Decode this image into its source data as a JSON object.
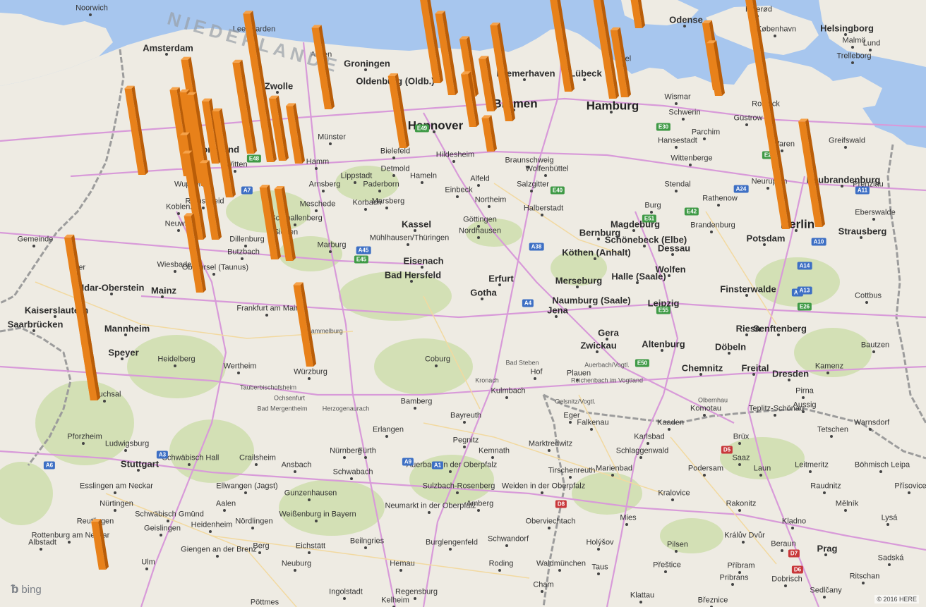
{
  "map": {
    "attribution": "© 2016 HERE",
    "logo_text": "bing",
    "logo_icon": "bing-b-icon",
    "colors": {
      "water": "#a7c6ee",
      "land": "#eeebe3",
      "forest": "#c9dca5",
      "roads": "#d89ad9",
      "minor_roads": "#f2d9a0",
      "borders": "#9c9c9c",
      "column_front": "#e8811a",
      "column_side": "#b95d08",
      "column_top": "#f6a24a"
    },
    "countries": [
      {
        "name": "NIEDERLANDE"
      }
    ],
    "cities_major": [
      "Hamburg",
      "Berlin",
      "Bremen",
      "Hannover",
      "Leipzig",
      "Dresden",
      "Chemnitz",
      "Prag",
      "Stuttgart",
      "Frankfurt am Main",
      "Dortmund",
      "Wuppertal"
    ],
    "cities": [
      {
        "name": "Hamburg",
        "rank": 1
      },
      {
        "name": "Berlin",
        "rank": 1
      },
      {
        "name": "Bremen",
        "rank": 1
      },
      {
        "name": "Hannover",
        "rank": 1
      },
      {
        "name": "Leipzig",
        "rank": 2
      },
      {
        "name": "Dresden",
        "rank": 2
      },
      {
        "name": "Chemnitz",
        "rank": 2
      },
      {
        "name": "Prag",
        "rank": 2
      },
      {
        "name": "Stuttgart",
        "rank": 2
      },
      {
        "name": "Frankfurt am Main",
        "rank": 3
      },
      {
        "name": "Dortmund",
        "rank": 2
      },
      {
        "name": "Wuppertal",
        "rank": 3
      },
      {
        "name": "Zwickau",
        "rank": 2
      },
      {
        "name": "Altenburg",
        "rank": 2
      },
      {
        "name": "Gera",
        "rank": 2
      },
      {
        "name": "Jena",
        "rank": 2
      },
      {
        "name": "Erfurt",
        "rank": 2
      },
      {
        "name": "Gotha",
        "rank": 2
      },
      {
        "name": "Eisenach",
        "rank": 2
      },
      {
        "name": "Halle (Saale)",
        "rank": 2
      },
      {
        "name": "Naumburg (Saale)",
        "rank": 2
      },
      {
        "name": "Dessau",
        "rank": 2
      },
      {
        "name": "Wolfen",
        "rank": 2
      },
      {
        "name": "Magdeburg",
        "rank": 2
      },
      {
        "name": "Schönebeck (Elbe)",
        "rank": 2
      },
      {
        "name": "Bernburg",
        "rank": 2
      },
      {
        "name": "Köthen (Anhalt)",
        "rank": 2
      },
      {
        "name": "Merseburg",
        "rank": 2
      },
      {
        "name": "Potsdam",
        "rank": 2
      },
      {
        "name": "Brandenburg",
        "rank": 3
      },
      {
        "name": "Strausberg",
        "rank": 2
      },
      {
        "name": "Neubrandenburg",
        "rank": 2
      },
      {
        "name": "Neuruppin",
        "rank": 3
      },
      {
        "name": "Rathenow",
        "rank": 3
      },
      {
        "name": "Stendal",
        "rank": 3
      },
      {
        "name": "Wittenberge",
        "rank": 3
      },
      {
        "name": "Schwerin",
        "rank": 3
      },
      {
        "name": "Güstrow",
        "rank": 3
      },
      {
        "name": "Rostock",
        "rank": 3
      },
      {
        "name": "Wismar",
        "rank": 3
      },
      {
        "name": "Lübeck",
        "rank": 2
      },
      {
        "name": "Kiel",
        "rank": 3
      },
      {
        "name": "Bremerhaven",
        "rank": 2
      },
      {
        "name": "Oldenburg (Oldb.)",
        "rank": 2
      },
      {
        "name": "Groningen",
        "rank": 2
      },
      {
        "name": "Assen",
        "rank": 3
      },
      {
        "name": "Zwolle",
        "rank": 2
      },
      {
        "name": "Amsterdam",
        "rank": 2
      },
      {
        "name": "Leeuwarden",
        "rank": 3
      },
      {
        "name": "Odense",
        "rank": 2
      },
      {
        "name": "København",
        "rank": 3
      },
      {
        "name": "Hillerød",
        "rank": 3
      },
      {
        "name": "Helsingborg",
        "rank": 2
      },
      {
        "name": "Lund",
        "rank": 3
      },
      {
        "name": "Trelleborg",
        "rank": 3
      },
      {
        "name": "Malmö",
        "rank": 3
      },
      {
        "name": "Hildesheim",
        "rank": 3
      },
      {
        "name": "Braunschweig",
        "rank": 3
      },
      {
        "name": "Salzgitter",
        "rank": 3
      },
      {
        "name": "Wolfenbüttel",
        "rank": 3
      },
      {
        "name": "Burg",
        "rank": 3
      },
      {
        "name": "Halberstadt",
        "rank": 3
      },
      {
        "name": "Göttingen",
        "rank": 3
      },
      {
        "name": "Nordhausen",
        "rank": 3
      },
      {
        "name": "Northeim",
        "rank": 3
      },
      {
        "name": "Einbeck",
        "rank": 3
      },
      {
        "name": "Alfeld",
        "rank": 3
      },
      {
        "name": "Hameln",
        "rank": 3
      },
      {
        "name": "Detmold",
        "rank": 3
      },
      {
        "name": "Paderborn",
        "rank": 3
      },
      {
        "name": "Lippstadt",
        "rank": 3
      },
      {
        "name": "Bielefeld",
        "rank": 3
      },
      {
        "name": "Münster",
        "rank": 3
      },
      {
        "name": "Hamm",
        "rank": 3
      },
      {
        "name": "Arnsberg",
        "rank": 3
      },
      {
        "name": "Meschede",
        "rank": 3
      },
      {
        "name": "Schmallenberg",
        "rank": 3
      },
      {
        "name": "Siegen",
        "rank": 3
      },
      {
        "name": "Dillenburg",
        "rank": 3
      },
      {
        "name": "Marburg",
        "rank": 3
      },
      {
        "name": "Korbach",
        "rank": 3
      },
      {
        "name": "Kassel",
        "rank": 2
      },
      {
        "name": "Marsberg",
        "rank": 3
      },
      {
        "name": "Mühlhausen/Thüringen",
        "rank": 3
      },
      {
        "name": "Bad Hersfeld",
        "rank": 2
      },
      {
        "name": "Remscheid",
        "rank": 3
      },
      {
        "name": "Witten",
        "rank": 3
      },
      {
        "name": "Neuwied",
        "rank": 3
      },
      {
        "name": "Koblenz",
        "rank": 3
      },
      {
        "name": "Butzbach",
        "rank": 3
      },
      {
        "name": "Oberursel (Taunus)",
        "rank": 3
      },
      {
        "name": "Wiesbaden",
        "rank": 3
      },
      {
        "name": "Mainz",
        "rank": 2
      },
      {
        "name": "Idar-Oberstein",
        "rank": 2
      },
      {
        "name": "Kaiserslautern",
        "rank": 2
      },
      {
        "name": "Mannheim",
        "rank": 2
      },
      {
        "name": "Saarbrücken",
        "rank": 2
      },
      {
        "name": "Speyer",
        "rank": 2
      },
      {
        "name": "Trier",
        "rank": 3
      },
      {
        "name": "Würzburg",
        "rank": 3
      },
      {
        "name": "Hammelburg",
        "rank": 4
      },
      {
        "name": "Bad Mergentheim",
        "rank": 4
      },
      {
        "name": "Herzogenaurach",
        "rank": 4
      },
      {
        "name": "Nürnberg",
        "rank": 3
      },
      {
        "name": "Fürth",
        "rank": 3
      },
      {
        "name": "Ansbach",
        "rank": 3
      },
      {
        "name": "Schwabach",
        "rank": 3
      },
      {
        "name": "Erlangen",
        "rank": 3
      },
      {
        "name": "Bamberg",
        "rank": 3
      },
      {
        "name": "Bayreuth",
        "rank": 3
      },
      {
        "name": "Kulmbach",
        "rank": 3
      },
      {
        "name": "Hof",
        "rank": 3
      },
      {
        "name": "Kronach",
        "rank": 4
      },
      {
        "name": "Bad Steben",
        "rank": 4
      },
      {
        "name": "Coburg",
        "rank": 3
      },
      {
        "name": "Pegnitz",
        "rank": 3
      },
      {
        "name": "Kemnath",
        "rank": 3
      },
      {
        "name": "Marktredwitz",
        "rank": 3
      },
      {
        "name": "Tirschenreuth",
        "rank": 3
      },
      {
        "name": "Weiden in der Oberpfalz",
        "rank": 3
      },
      {
        "name": "Auerbach in der Oberpfalz",
        "rank": 3
      },
      {
        "name": "Sulzbach-Rosenberg",
        "rank": 3
      },
      {
        "name": "Amberg",
        "rank": 3
      },
      {
        "name": "Neumarkt in der Oberpfalz",
        "rank": 3
      },
      {
        "name": "Schwandorf",
        "rank": 3
      },
      {
        "name": "Burglengenfeld",
        "rank": 3
      },
      {
        "name": "Regensburg",
        "rank": 3
      },
      {
        "name": "Hemau",
        "rank": 3
      },
      {
        "name": "Beilngries",
        "rank": 3
      },
      {
        "name": "Eichstätt",
        "rank": 3
      },
      {
        "name": "Ingolstadt",
        "rank": 3
      },
      {
        "name": "Neuburg",
        "rank": 3
      },
      {
        "name": "Weißenburg in Bayern",
        "rank": 3
      },
      {
        "name": "Gunzenhausen",
        "rank": 3
      },
      {
        "name": "Nördlingen",
        "rank": 3
      },
      {
        "name": "Ellwangen (Jagst)",
        "rank": 3
      },
      {
        "name": "Aalen",
        "rank": 3
      },
      {
        "name": "Heidenheim",
        "rank": 3
      },
      {
        "name": "Schwäbisch Hall",
        "rank": 3
      },
      {
        "name": "Schwäbisch Gmünd",
        "rank": 3
      },
      {
        "name": "Crailsheim",
        "rank": 3
      },
      {
        "name": "Giengen an der Brenz",
        "rank": 3
      },
      {
        "name": "Ulm",
        "rank": 3
      },
      {
        "name": "Geislingen",
        "rank": 3
      },
      {
        "name": "Esslingen am Neckar",
        "rank": 3
      },
      {
        "name": "Reutlingen",
        "rank": 3
      },
      {
        "name": "Nürtingen",
        "rank": 3
      },
      {
        "name": "Rottenburg am Neckar",
        "rank": 3
      },
      {
        "name": "Albstadt",
        "rank": 3
      },
      {
        "name": "Ludwigsburg",
        "rank": 3
      },
      {
        "name": "Heidelberg",
        "rank": 3
      },
      {
        "name": "Bruchsal",
        "rank": 3
      },
      {
        "name": "Pforzheim",
        "rank": 3
      },
      {
        "name": "Wertheim",
        "rank": 3
      },
      {
        "name": "Tauberbischofsheim",
        "rank": 4
      },
      {
        "name": "Ochsenfurt",
        "rank": 4
      },
      {
        "name": "Berg",
        "rank": 3
      },
      {
        "name": "Pöttmes",
        "rank": 3
      },
      {
        "name": "Kelheim",
        "rank": 3
      },
      {
        "name": "Roding",
        "rank": 3
      },
      {
        "name": "Cham",
        "rank": 3
      },
      {
        "name": "Waldmünchen",
        "rank": 3
      },
      {
        "name": "Oberviechtach",
        "rank": 3
      },
      {
        "name": "Marienbad",
        "rank": 3
      },
      {
        "name": "Schlaggenwald",
        "rank": 3
      },
      {
        "name": "Karlsbad",
        "rank": 3
      },
      {
        "name": "Falkenau",
        "rank": 3
      },
      {
        "name": "Eger",
        "rank": 3
      },
      {
        "name": "Kaaden",
        "rank": 3
      },
      {
        "name": "Komotau",
        "rank": 3
      },
      {
        "name": "Brüx",
        "rank": 3
      },
      {
        "name": "Teplitz-Schönau",
        "rank": 3
      },
      {
        "name": "Aussig",
        "rank": 3
      },
      {
        "name": "Tetschen",
        "rank": 3
      },
      {
        "name": "Böhmisch Leipa",
        "rank": 3
      },
      {
        "name": "Leitmeritz",
        "rank": 3
      },
      {
        "name": "Raudnitz",
        "rank": 3
      },
      {
        "name": "Mělník",
        "rank": 3
      },
      {
        "name": "Kladno",
        "rank": 3
      },
      {
        "name": "Rakonitz",
        "rank": 3
      },
      {
        "name": "Podersam",
        "rank": 3
      },
      {
        "name": "Saaz",
        "rank": 3
      },
      {
        "name": "Laun",
        "rank": 3
      },
      {
        "name": "Kralovice",
        "rank": 3
      },
      {
        "name": "Mies",
        "rank": 3
      },
      {
        "name": "Pilsen",
        "rank": 3
      },
      {
        "name": "Holýšov",
        "rank": 3
      },
      {
        "name": "Taus",
        "rank": 3
      },
      {
        "name": "Přeštice",
        "rank": 3
      },
      {
        "name": "Klattau",
        "rank": 3
      },
      {
        "name": "Pribrans",
        "rank": 3
      },
      {
        "name": "Příbram",
        "rank": 3
      },
      {
        "name": "Beraun",
        "rank": 3
      },
      {
        "name": "Králův Dvůr",
        "rank": 3
      },
      {
        "name": "Dobrisch",
        "rank": 3
      },
      {
        "name": "Březnice",
        "rank": 3
      },
      {
        "name": "Sedlčany",
        "rank": 3
      },
      {
        "name": "Ritschan",
        "rank": 3
      },
      {
        "name": "Sadská",
        "rank": 3
      },
      {
        "name": "Lysá",
        "rank": 3
      },
      {
        "name": "Přísovice",
        "rank": 3
      },
      {
        "name": "Riesa",
        "rank": 2
      },
      {
        "name": "Finsterwalde",
        "rank": 2
      },
      {
        "name": "Senftenberg",
        "rank": 2
      },
      {
        "name": "Döbeln",
        "rank": 2
      },
      {
        "name": "Freital",
        "rank": 2
      },
      {
        "name": "Plauen",
        "rank": 3
      },
      {
        "name": "Auerbach/Vogtl.",
        "rank": 4
      },
      {
        "name": "Oelsnitz/Vogtl.",
        "rank": 4
      },
      {
        "name": "Reichenbach im Vogtland",
        "rank": 4
      },
      {
        "name": "Olbernhau",
        "rank": 4
      },
      {
        "name": "Pirna",
        "rank": 3
      },
      {
        "name": "Warnsdorf",
        "rank": 3
      },
      {
        "name": "Kamenz",
        "rank": 3
      },
      {
        "name": "Bautzen",
        "rank": 3
      },
      {
        "name": "Cottbus",
        "rank": 3
      },
      {
        "name": "Eberswalde",
        "rank": 3
      },
      {
        "name": "Prenzlau",
        "rank": 3
      },
      {
        "name": "Greifswald",
        "rank": 3
      },
      {
        "name": "Waren",
        "rank": 3
      },
      {
        "name": "Parchim",
        "rank": 3
      },
      {
        "name": "Hansestadt",
        "rank": 3
      },
      {
        "name": "Gemeinde",
        "rank": 3
      },
      {
        "name": "Noorwich",
        "rank": 3
      }
    ],
    "road_shields": [
      {
        "label": "A1",
        "type": "A"
      },
      {
        "label": "A2",
        "type": "A"
      },
      {
        "label": "A4",
        "type": "A"
      },
      {
        "label": "A7",
        "type": "A"
      },
      {
        "label": "A9",
        "type": "A"
      },
      {
        "label": "A10",
        "type": "A"
      },
      {
        "label": "A11",
        "type": "A"
      },
      {
        "label": "A13",
        "type": "A"
      },
      {
        "label": "A14",
        "type": "A"
      },
      {
        "label": "A24",
        "type": "A"
      },
      {
        "label": "A38",
        "type": "A"
      },
      {
        "label": "A45",
        "type": "A"
      },
      {
        "label": "A6",
        "type": "A"
      },
      {
        "label": "A3",
        "type": "A"
      },
      {
        "label": "E30",
        "type": "E"
      },
      {
        "label": "E40",
        "type": "E"
      },
      {
        "label": "E45",
        "type": "E"
      },
      {
        "label": "E48",
        "type": "E"
      },
      {
        "label": "E49",
        "type": "E"
      },
      {
        "label": "E51",
        "type": "E"
      },
      {
        "label": "E55",
        "type": "E"
      },
      {
        "label": "E26",
        "type": "E"
      },
      {
        "label": "E22",
        "type": "E"
      },
      {
        "label": "E42",
        "type": "E"
      },
      {
        "label": "E50",
        "type": "E"
      },
      {
        "label": "D5",
        "type": "D"
      },
      {
        "label": "D6",
        "type": "D"
      },
      {
        "label": "D7",
        "type": "D"
      },
      {
        "label": "D8",
        "type": "D"
      }
    ],
    "data_columns_count": 38,
    "data_columns": [
      {
        "id": 1,
        "value": 100
      },
      {
        "id": 2,
        "value": 44
      },
      {
        "id": 3,
        "value": 22
      },
      {
        "id": 4,
        "value": 50
      },
      {
        "id": 5,
        "value": 28
      },
      {
        "id": 6,
        "value": 80
      },
      {
        "id": 7,
        "value": 40
      },
      {
        "id": 8,
        "value": 22
      },
      {
        "id": 9,
        "value": 14
      },
      {
        "id": 10,
        "value": 22
      },
      {
        "id": 11,
        "value": 24
      },
      {
        "id": 12,
        "value": 34
      },
      {
        "id": 13,
        "value": 40
      },
      {
        "id": 14,
        "value": 30
      },
      {
        "id": 15,
        "value": 34
      },
      {
        "id": 16,
        "value": 24
      },
      {
        "id": 17,
        "value": 26
      },
      {
        "id": 18,
        "value": 62
      },
      {
        "id": 19,
        "value": 38
      },
      {
        "id": 20,
        "value": 36
      },
      {
        "id": 21,
        "value": 26
      },
      {
        "id": 22,
        "value": 36
      },
      {
        "id": 23,
        "value": 38
      },
      {
        "id": 24,
        "value": 28
      },
      {
        "id": 25,
        "value": 36
      },
      {
        "id": 26,
        "value": 32
      },
      {
        "id": 27,
        "value": 36
      },
      {
        "id": 28,
        "value": 30
      },
      {
        "id": 29,
        "value": 30
      },
      {
        "id": 30,
        "value": 32
      },
      {
        "id": 31,
        "value": 34
      },
      {
        "id": 32,
        "value": 28
      },
      {
        "id": 33,
        "value": 68
      },
      {
        "id": 34,
        "value": 36
      },
      {
        "id": 35,
        "value": 38
      },
      {
        "id": 36,
        "value": 20
      },
      {
        "id": 37,
        "value": 28
      },
      {
        "id": 38,
        "value": 14
      }
    ]
  }
}
